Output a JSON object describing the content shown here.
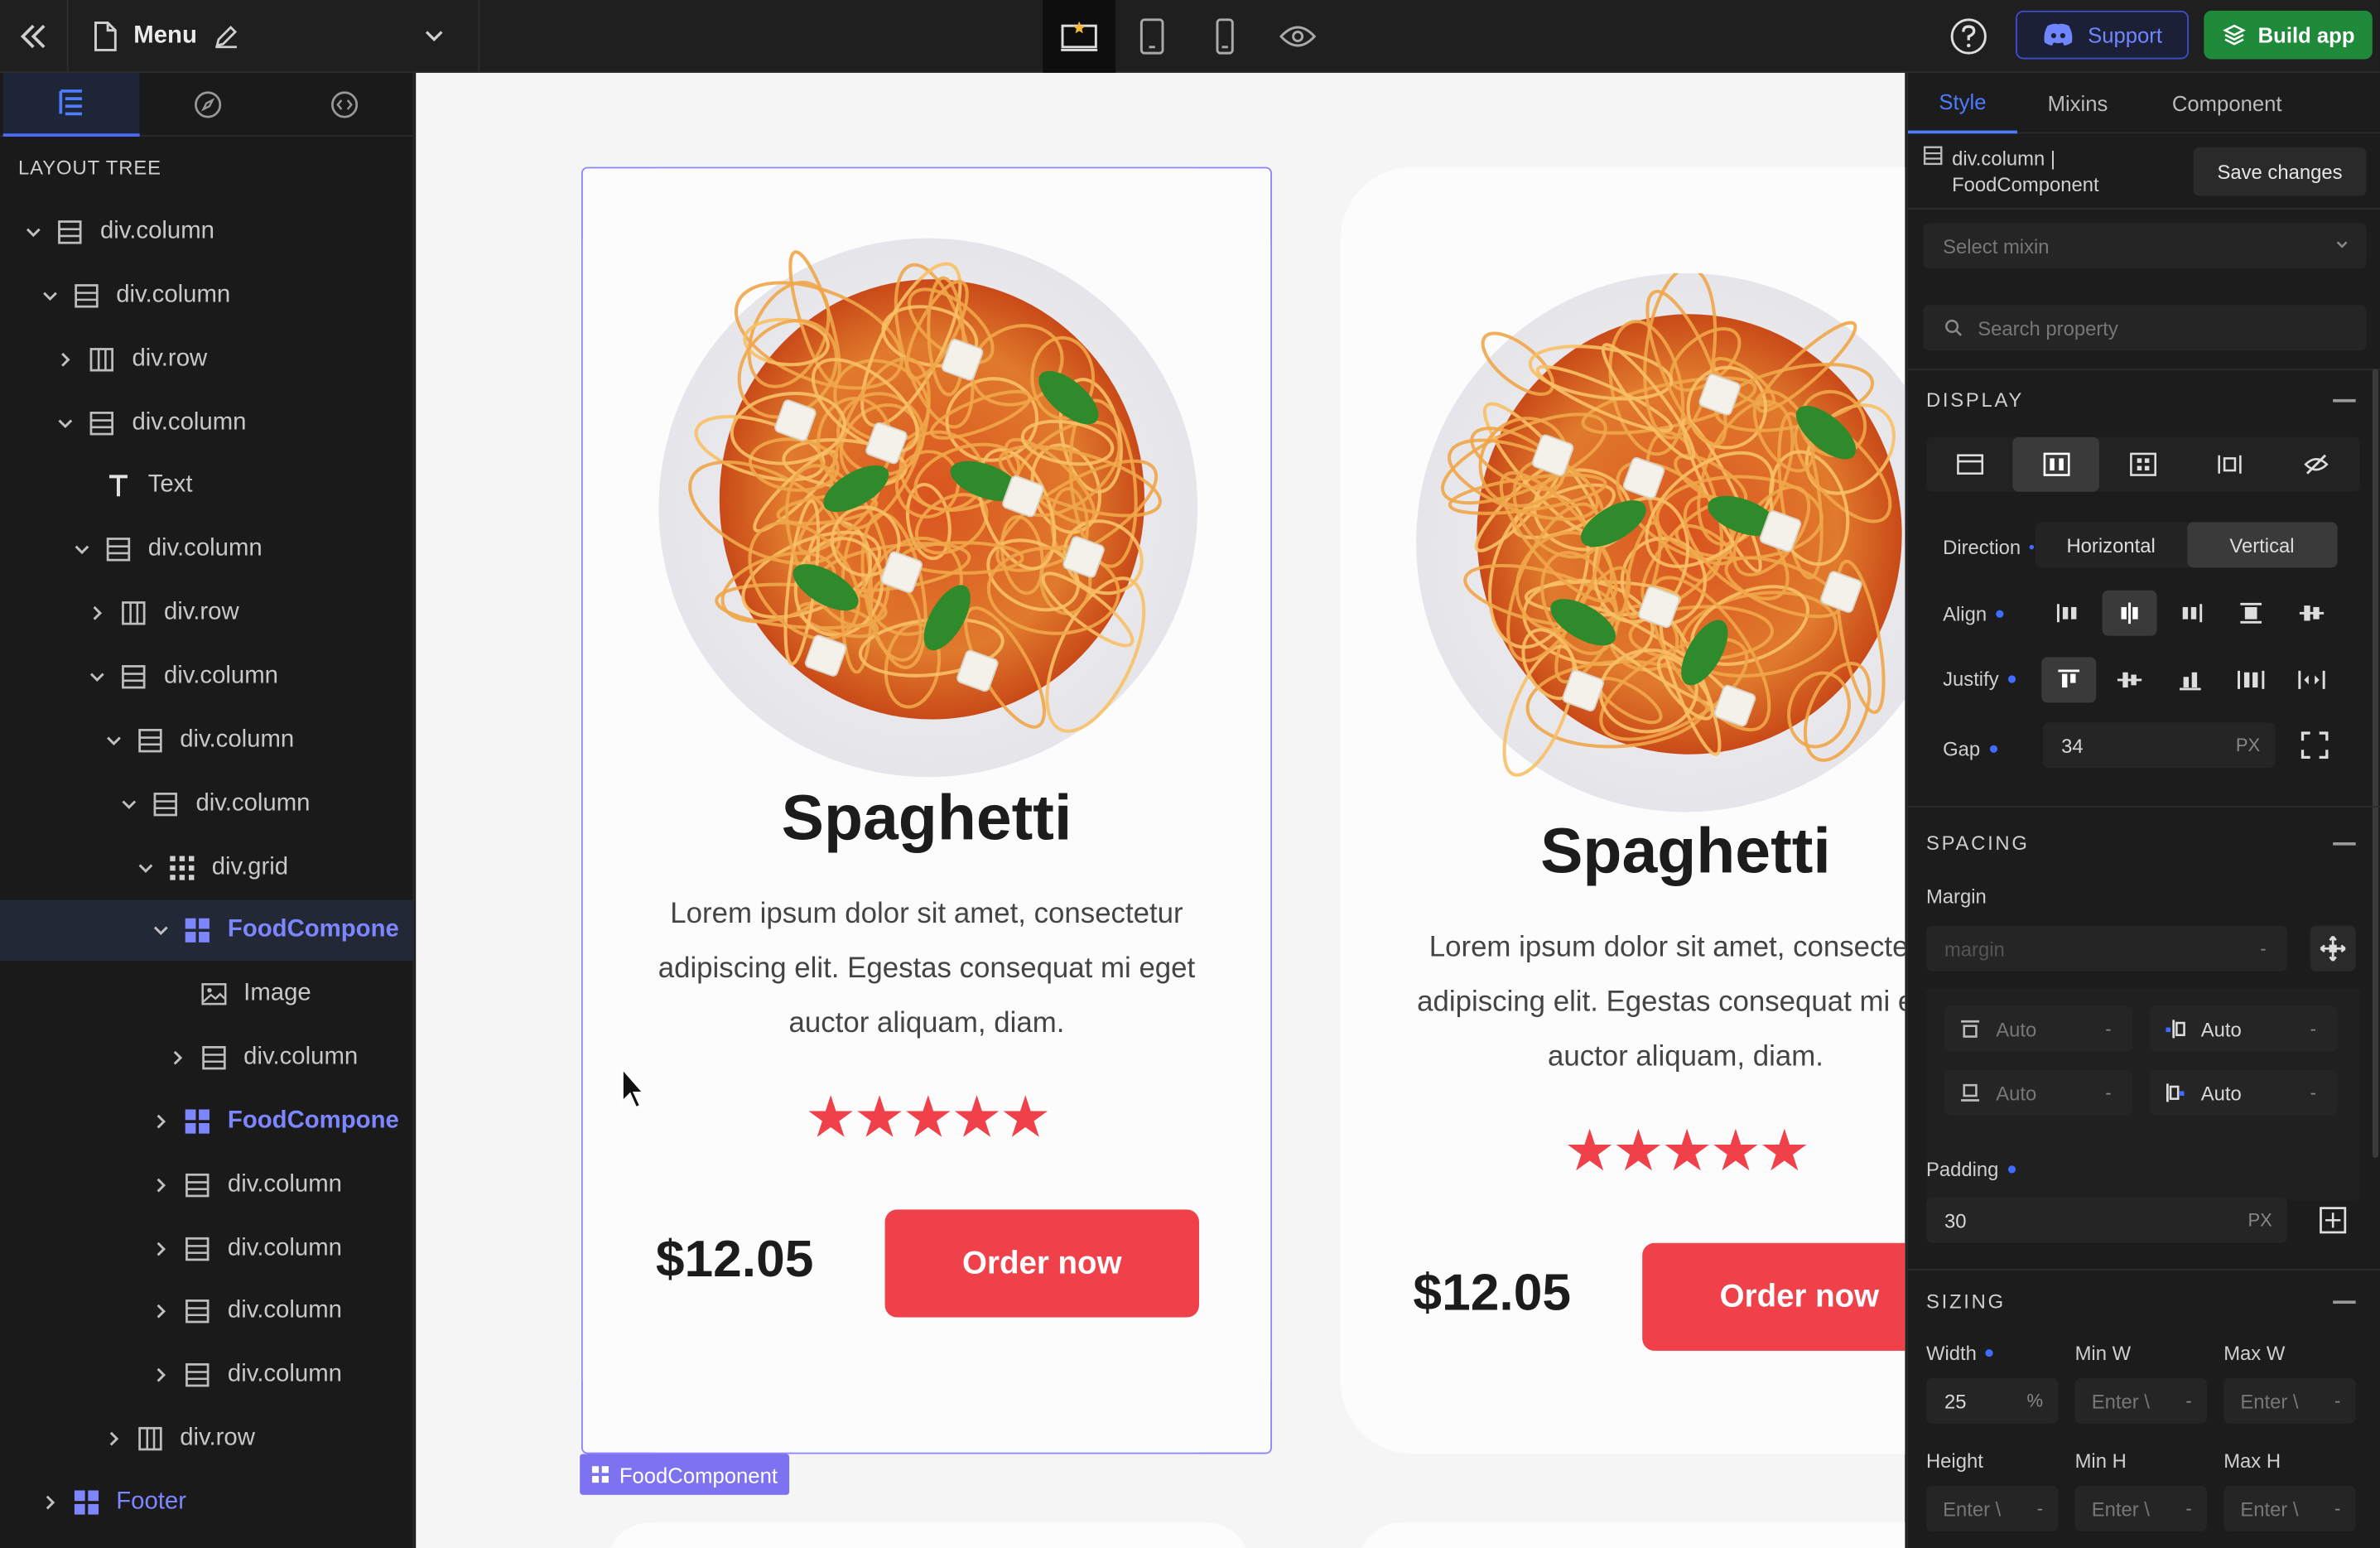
{
  "topbar": {
    "page_title": "Menu",
    "support_label": "Support",
    "build_label": "Build app"
  },
  "left_panel": {
    "tree_heading": "LAYOUT TREE",
    "nodes": [
      {
        "label": "div.column",
        "depth": 0,
        "icon": "column-icon",
        "caret": "down"
      },
      {
        "label": "div.column",
        "depth": 1,
        "icon": "column-icon",
        "caret": "down"
      },
      {
        "label": "div.row",
        "depth": 2,
        "icon": "row-icon",
        "caret": "right"
      },
      {
        "label": "div.column",
        "depth": 2,
        "icon": "column-icon",
        "caret": "down"
      },
      {
        "label": "Text",
        "depth": 3,
        "icon": "text-icon",
        "caret": "none"
      },
      {
        "label": "div.column",
        "depth": 3,
        "icon": "column-icon",
        "caret": "down"
      },
      {
        "label": "div.row",
        "depth": 4,
        "icon": "row-icon",
        "caret": "right"
      },
      {
        "label": "div.column",
        "depth": 4,
        "icon": "column-icon",
        "caret": "down"
      },
      {
        "label": "div.column",
        "depth": 5,
        "icon": "column-icon",
        "caret": "down"
      },
      {
        "label": "div.column",
        "depth": 6,
        "icon": "column-icon",
        "caret": "down"
      },
      {
        "label": "div.grid",
        "depth": 7,
        "icon": "grid-icon",
        "caret": "down"
      },
      {
        "label": "FoodCompone",
        "depth": 8,
        "icon": "component-icon",
        "caret": "down",
        "component": true,
        "selected": true
      },
      {
        "label": "Image",
        "depth": 9,
        "icon": "image-icon",
        "caret": "none"
      },
      {
        "label": "div.column",
        "depth": 9,
        "icon": "column-icon",
        "caret": "right"
      },
      {
        "label": "FoodCompone",
        "depth": 8,
        "icon": "component-icon",
        "caret": "right",
        "component": true
      },
      {
        "label": "div.column",
        "depth": 8,
        "icon": "column-icon",
        "caret": "right"
      },
      {
        "label": "div.column",
        "depth": 8,
        "icon": "column-icon",
        "caret": "right"
      },
      {
        "label": "div.column",
        "depth": 8,
        "icon": "column-icon",
        "caret": "right"
      },
      {
        "label": "div.column",
        "depth": 8,
        "icon": "column-icon",
        "caret": "right"
      },
      {
        "label": "div.row",
        "depth": 5,
        "icon": "row-icon",
        "caret": "right"
      },
      {
        "label": "Footer",
        "depth": 1,
        "icon": "component-icon",
        "caret": "right",
        "footer": true
      }
    ]
  },
  "canvas": {
    "cards": [
      {
        "title": "Spaghetti",
        "description": "Lorem ipsum dolor sit amet, consectetur adipiscing elit. Egestas consequat mi eget auctor aliquam, diam.",
        "stars": "★★★★★",
        "rating": 5,
        "price": "$12.05",
        "button": "Order now"
      },
      {
        "title": "Spaghetti",
        "description": "Lorem ipsum dolor sit amet, consectetur adipiscing elit. Egestas consequat mi eget auctor aliquam, diam.",
        "stars": "★★★★★",
        "rating": 5,
        "price": "$12.05",
        "button": "Order now"
      }
    ],
    "selected_tag": "FoodComponent",
    "colors": {
      "accent_red": "#f0414b",
      "selection": "#8a84ff",
      "tag_bg": "#7d72f0"
    }
  },
  "right_panel": {
    "tabs": [
      "Style",
      "Mixins",
      "Component"
    ],
    "active_tab": "Style",
    "selection_line1": "div.column |",
    "selection_line2": "FoodComponent",
    "save_label": "Save changes",
    "mixin_placeholder": "Select mixin",
    "search_placeholder": "Search property",
    "display": {
      "title": "DISPLAY",
      "direction_label": "Direction",
      "direction_options": [
        "Horizontal",
        "Vertical"
      ],
      "direction_value": "Vertical",
      "align_label": "Align",
      "justify_label": "Justify",
      "gap_label": "Gap",
      "gap_value": "34",
      "gap_unit": "PX"
    },
    "spacing": {
      "title": "SPACING",
      "margin_label": "Margin",
      "margin_placeholder": "margin",
      "margin_top": "Auto",
      "margin_right": "Auto",
      "margin_bottom": "Auto",
      "margin_left": "Auto",
      "padding_label": "Padding",
      "padding_value": "30",
      "padding_unit": "PX"
    },
    "sizing": {
      "title": "SIZING",
      "width_label": "Width",
      "width_value": "25",
      "width_unit": "%",
      "min_w_label": "Min W",
      "max_w_label": "Max W",
      "height_label": "Height",
      "min_h_label": "Min H",
      "max_h_label": "Max H",
      "enter_placeholder": "Enter \\"
    }
  }
}
